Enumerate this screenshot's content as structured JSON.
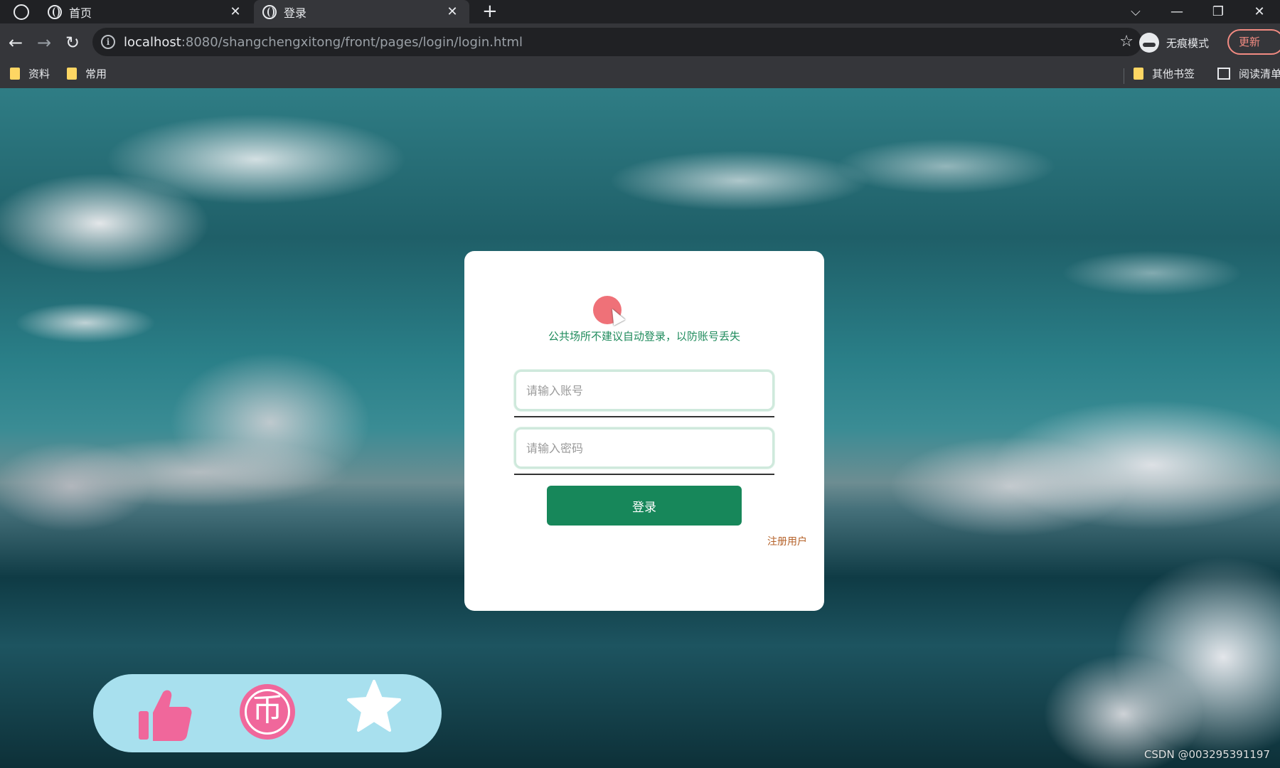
{
  "browser": {
    "tabs": [
      {
        "title": "首页",
        "active": false
      },
      {
        "title": "登录",
        "active": true
      }
    ],
    "close_glyph": "✕",
    "new_tab_glyph": "+",
    "window_controls": {
      "dropdown": "⌵",
      "minimize": "—",
      "restore": "❐",
      "close": "✕"
    },
    "nav": {
      "back": "←",
      "forward": "→",
      "reload": "↻"
    },
    "address": {
      "host": "localhost",
      "path": ":8080/shangchengxitong/front/pages/login/login.html"
    },
    "star_glyph": "☆",
    "incognito_label": "无痕模式",
    "update_label": "更新",
    "bookmarks": [
      "资料",
      "常用"
    ],
    "other_bookmarks": "其他书签",
    "reading_list": "阅读清单"
  },
  "login": {
    "notice": "公共场所不建议自动登录，以防账号丢失",
    "username_placeholder": "请输入账号",
    "password_placeholder": "请输入密码",
    "submit_label": "登录",
    "register_label": "注册用户"
  },
  "actions": {
    "coin_glyph": "币"
  },
  "watermark": "CSDN @003295391197",
  "colors": {
    "accent_green": "#17875a",
    "notice_green": "#1f8b5c",
    "register_brown": "#b5622a",
    "action_pink": "#f0679b",
    "action_bar_bg": "#a8e0ee"
  },
  "icons": [
    "browser-logo-icon",
    "globe-icon",
    "info-icon",
    "star-icon",
    "incognito-icon",
    "folder-icon",
    "reading-list-icon",
    "thumbs-up-icon",
    "coin-icon",
    "favorite-star-icon",
    "cursor-icon"
  ]
}
